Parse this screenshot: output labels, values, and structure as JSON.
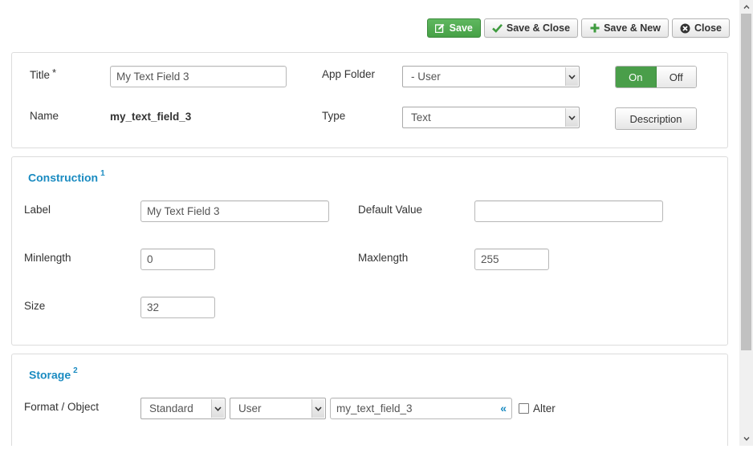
{
  "toolbar": {
    "save": "Save",
    "save_close": "Save & Close",
    "save_new": "Save & New",
    "close": "Close"
  },
  "general": {
    "title_label": "Title",
    "required_mark": "*",
    "title_value": "My Text Field 3",
    "name_label": "Name",
    "name_value": "my_text_field_3",
    "app_folder_label": "App Folder",
    "app_folder_value": "- User",
    "type_label": "Type",
    "type_value": "Text",
    "toggle_on": "On",
    "toggle_off": "Off",
    "description_button": "Description"
  },
  "construction": {
    "title": "Construction",
    "title_sup": "1",
    "label_label": "Label",
    "label_value": "My Text Field 3",
    "default_value_label": "Default Value",
    "default_value": "",
    "minlength_label": "Minlength",
    "minlength_value": "0",
    "maxlength_label": "Maxlength",
    "maxlength_value": "255",
    "size_label": "Size",
    "size_value": "32"
  },
  "storage": {
    "title": "Storage",
    "title_sup": "2",
    "format_label": "Format / Object",
    "format_value": "Standard",
    "object_value": "User",
    "column_value": "my_text_field_3",
    "swap_glyph": "«",
    "alter_label": "Alter"
  },
  "colors": {
    "accent": "#1a8bc1",
    "success": "#4a9e4a"
  },
  "icons": [
    "edit-icon",
    "check-icon",
    "plus-icon",
    "close-circle-icon",
    "chevron-down-icon",
    "swap-icon",
    "scroll-up-icon",
    "scroll-down-icon"
  ]
}
